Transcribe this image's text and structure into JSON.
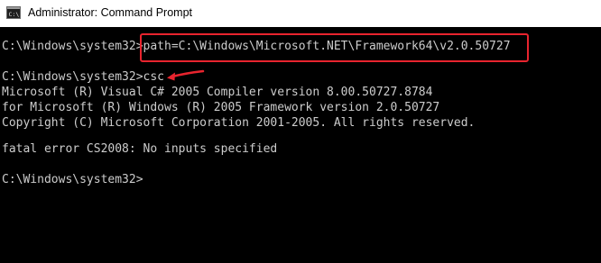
{
  "window": {
    "title": "Administrator: Command Prompt",
    "icon": "cmd-icon",
    "annotation_color": "#e8242e"
  },
  "console": {
    "lines": [
      "C:\\Windows\\system32>path=C:\\Windows\\Microsoft.NET\\Framework64\\v2.0.50727",
      "C:\\Windows\\system32>csc",
      "Microsoft (R) Visual C# 2005 Compiler version 8.00.50727.8784",
      "for Microsoft (R) Windows (R) 2005 Framework version 2.0.50727",
      "Copyright (C) Microsoft Corporation 2001-2005. All rights reserved.",
      "fatal error CS2008: No inputs specified",
      "C:\\Windows\\system32>"
    ]
  }
}
